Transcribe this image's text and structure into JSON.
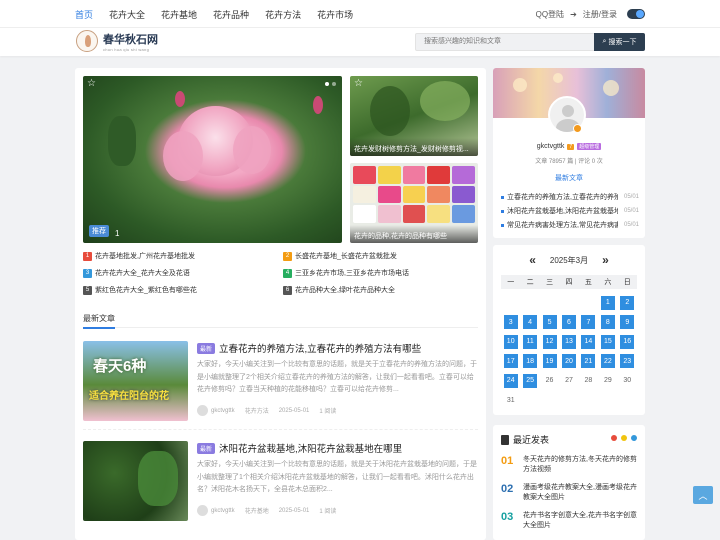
{
  "nav": {
    "items": [
      "首页",
      "花卉大全",
      "花卉基地",
      "花卉品种",
      "花卉方法",
      "花卉市场"
    ],
    "qq_login": "QQ登陆",
    "register": "注册/登录"
  },
  "header": {
    "logo_title": "春华秋石网",
    "logo_sub": "chun hua qiu shi wang",
    "search_placeholder": "搜索感兴趣的知识和文章",
    "search_button": "搜索一下"
  },
  "slider": {
    "badge": "推荐",
    "num": "1",
    "side1_caption": "花卉发财树修剪方法_发财树修剪视...",
    "side2_caption": "花卉的品种,花卉的品种有哪些"
  },
  "hot": [
    {
      "n": "1",
      "color": "#e74c3c",
      "text": "花卉基地批发,广州花卉基地批发"
    },
    {
      "n": "2",
      "color": "#f39c12",
      "text": "长盛花卉基地_长盛花卉盆栽批发"
    },
    {
      "n": "3",
      "color": "#3498db",
      "text": "花卉花卉大全_花卉大全及花语"
    },
    {
      "n": "4",
      "color": "#27ae60",
      "text": "三亚乡花卉市场,三亚乡花卉市场电话"
    },
    {
      "n": "5",
      "color": "#555555",
      "text": "紫红色花卉大全_紫红色有哪些花"
    },
    {
      "n": "6",
      "color": "#555555",
      "text": "花卉品种大全,绿叶花卉品种大全"
    }
  ],
  "tab": "最新文章",
  "articles": [
    {
      "tag": "最新",
      "title": "立春花卉的养殖方法,立春花卉的养殖方法有哪些",
      "desc": "大家好，今天小编关注到一个比较有意思的话题，就是关于立春花卉的养殖方法的问题，于是小编就整理了2个相关介绍立春花卉的养殖方法的解答，让我们一起看看吧。立春可以给花卉修剪吗？立春当天种植的花能移植吗？立春可以给花卉修剪...",
      "author": "gkctvgttk",
      "category": "花卉方法",
      "date": "2025-05-01",
      "views": "1 阅读",
      "img_text1": "春天6种",
      "img_text2": "适合养在阳台的花"
    },
    {
      "tag": "最新",
      "title": "沐阳花卉盆栽基地,沐阳花卉盆栽基地在哪里",
      "desc": "大家好，今天小编关注到一个比较有意思的话题，就是关于沐阳花卉盆栽基地的问题，于是小编就整理了1个相关介绍沐阳花卉盆栽基地的解答，让我们一起看看吧。沭阳什么花卉出名？沭阳花木名扬天下，全县花木总面积2...",
      "author": "gkctvgttk",
      "category": "花卉基地",
      "date": "2025-05-01",
      "views": "1 阅读"
    }
  ],
  "profile": {
    "name": "gkctvgttk",
    "level": "7",
    "role": "超级管理",
    "stats": "文章 78957 篇 | 评论 0 次",
    "latest_label": "最新文章",
    "latest": [
      {
        "title": "立春花卉的养殖方法,立春花卉的养殖方法有哪些",
        "date": "05/01"
      },
      {
        "title": "沐阳花卉盆栽基地,沐阳花卉盆栽基地在哪里",
        "date": "05/01"
      },
      {
        "title": "常见花卉病害处理方法,常见花卉病害",
        "date": "05/01"
      }
    ]
  },
  "calendar": {
    "prev": "«",
    "next": "»",
    "title": "2025年3月",
    "weekdays": [
      "一",
      "二",
      "三",
      "四",
      "五",
      "六",
      "日"
    ],
    "days": [
      "",
      "",
      "",
      "",
      "",
      "1",
      "2",
      "3",
      "4",
      "5",
      "6",
      "7",
      "8",
      "9",
      "10",
      "11",
      "12",
      "13",
      "14",
      "15",
      "16",
      "17",
      "18",
      "19",
      "20",
      "21",
      "22",
      "23",
      "24",
      "25",
      "26",
      "27",
      "28",
      "29",
      "30",
      "31"
    ],
    "highlight_until": 25
  },
  "recent": {
    "title": "最近发表",
    "items": [
      {
        "n": "01",
        "color": "#f39c12",
        "text": "冬天花卉的修剪方法,冬天花卉的修剪方法视频"
      },
      {
        "n": "02",
        "color": "#2c6fb0",
        "text": "漫画考级花卉教案大全,漫画考级花卉教案大全图片"
      },
      {
        "n": "03",
        "color": "#16a0a0",
        "text": "花卉书名字创意大全,花卉书名字创意大全图片"
      }
    ]
  },
  "colors": {
    "accent": "#2f7de1",
    "dark": "#2c3e50"
  }
}
